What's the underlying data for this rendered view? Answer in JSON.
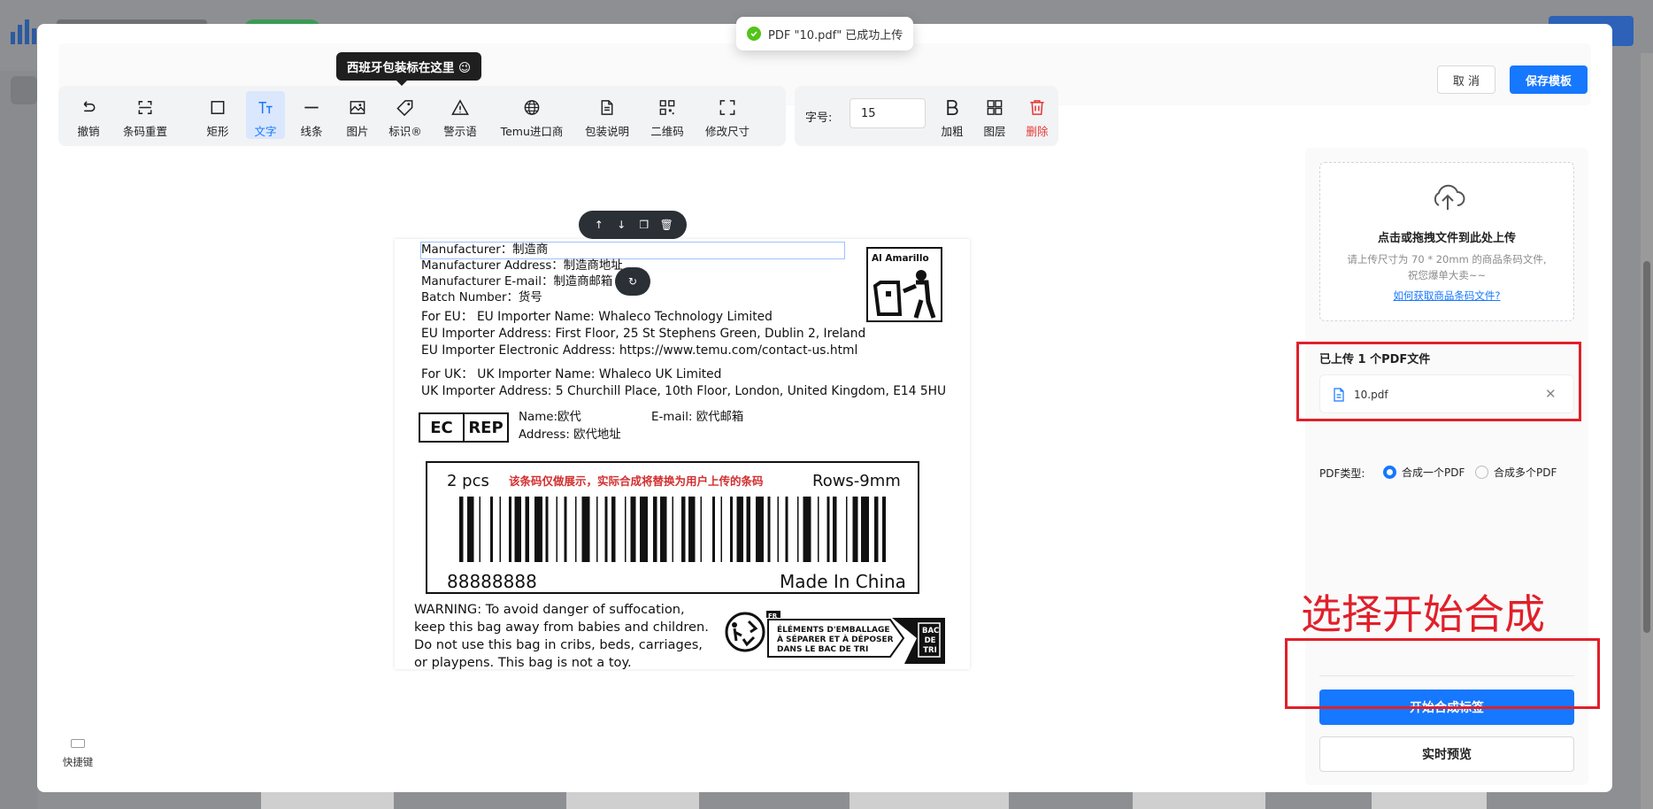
{
  "background": {
    "scrollbar": "scrollbar"
  },
  "header": {
    "cancel_label": "取 消",
    "save_label": "保存模板"
  },
  "toast": {
    "message": "PDF \"10.pdf\" 已成功上传",
    "status_color": "#52c41a"
  },
  "toolbar": {
    "group1": [
      {
        "label": "撤销",
        "icon": "undo-icon"
      },
      {
        "label": "条码重置",
        "icon": "barcode-reset-icon"
      }
    ],
    "group2": [
      {
        "label": "矩形",
        "icon": "rectangle-icon"
      },
      {
        "label": "文字",
        "icon": "text-icon",
        "active": true
      },
      {
        "label": "线条",
        "icon": "line-icon"
      },
      {
        "label": "图片",
        "icon": "image-icon"
      },
      {
        "label": "标识®",
        "icon": "tag-icon"
      },
      {
        "label": "警示语",
        "icon": "warning-icon"
      },
      {
        "label": "Temu进口商",
        "icon": "globe-icon"
      },
      {
        "label": "包装说明",
        "icon": "document-icon"
      },
      {
        "label": "二维码",
        "icon": "qrcode-icon"
      },
      {
        "label": "修改尺寸",
        "icon": "resize-icon"
      }
    ],
    "font_size_label": "字号:",
    "font_size_value": "15",
    "group3": [
      {
        "label": "加粗",
        "icon": "bold-icon"
      },
      {
        "label": "图层",
        "icon": "layers-icon"
      },
      {
        "label": "删除",
        "icon": "delete-icon",
        "danger": true
      }
    ],
    "tooltip": "西班牙包装标在这里 😉"
  },
  "label": {
    "manufacturer": "Manufacturer：制造商",
    "manufacturer_address": "Manufacturer Address：制造商地址",
    "manufacturer_email": "Manufacturer E-mail：制造商邮箱",
    "batch_number": "Batch Number：货号",
    "eu_line1": "For EU： EU Importer Name: Whaleco Technology Limited",
    "eu_line2": "EU Importer Address: First Floor, 25 St Stephens Green, Dublin 2, Ireland",
    "eu_line3": "EU Importer Electronic Address: https://www.temu.com/contact-us.html",
    "uk_line1": "For UK： UK Importer Name: Whaleco UK Limited",
    "uk_line2": "UK Importer Address: 5 Churchill Place, 10th Floor, London, United  Kingdom, E14 5HU",
    "ec_left": "EC",
    "ec_right": "REP",
    "rep_name": "Name:欧代",
    "rep_email": "E-mail: 欧代邮箱",
    "rep_address": "Address: 欧代地址",
    "barcode_pcs": "2 pcs",
    "barcode_notice": "该条码仅做展示，实际合成将替换为用户上传的条码",
    "barcode_rows": "Rows-9mm",
    "barcode_number": "88888888",
    "barcode_origin": "Made In China",
    "warning": "WARNING: To avoid danger of suffocation, keep this bag away from babies and children. Do not use this bag in cribs, beds, carriages, or playpens. This bag is not a toy.",
    "ai_amarillo": "Al Amarillo",
    "fr_code": "FR",
    "fr_text1": "ÉLÉMENTS D'EMBALLAGE",
    "fr_text2": "À SÉPARER ET À DÉPOSER",
    "fr_text3": "DANS LE BAC DE TRI",
    "bac1": "BAC",
    "bac2": "DE",
    "bac3": "TRI"
  },
  "right_panel": {
    "upload_title": "点击或拖拽文件到此处上传",
    "upload_desc1": "请上传尺寸为 70 * 20mm 的商品条码文件,",
    "upload_desc2": "祝您爆单大卖~~",
    "upload_link": "如何获取商品条码文件?",
    "uploaded_count": "已上传 1 个PDF文件",
    "file_name": "10.pdf",
    "pdf_type_label": "PDF类型:",
    "option_single": "合成一个PDF",
    "option_multi": "合成多个PDF",
    "start_label": "开始合成标签",
    "preview_label": "实时预览",
    "primary_color": "#1677ff"
  },
  "annotation": {
    "text": "选择开始合成",
    "color": "#e0202a"
  },
  "shortcut_label": "快捷键"
}
